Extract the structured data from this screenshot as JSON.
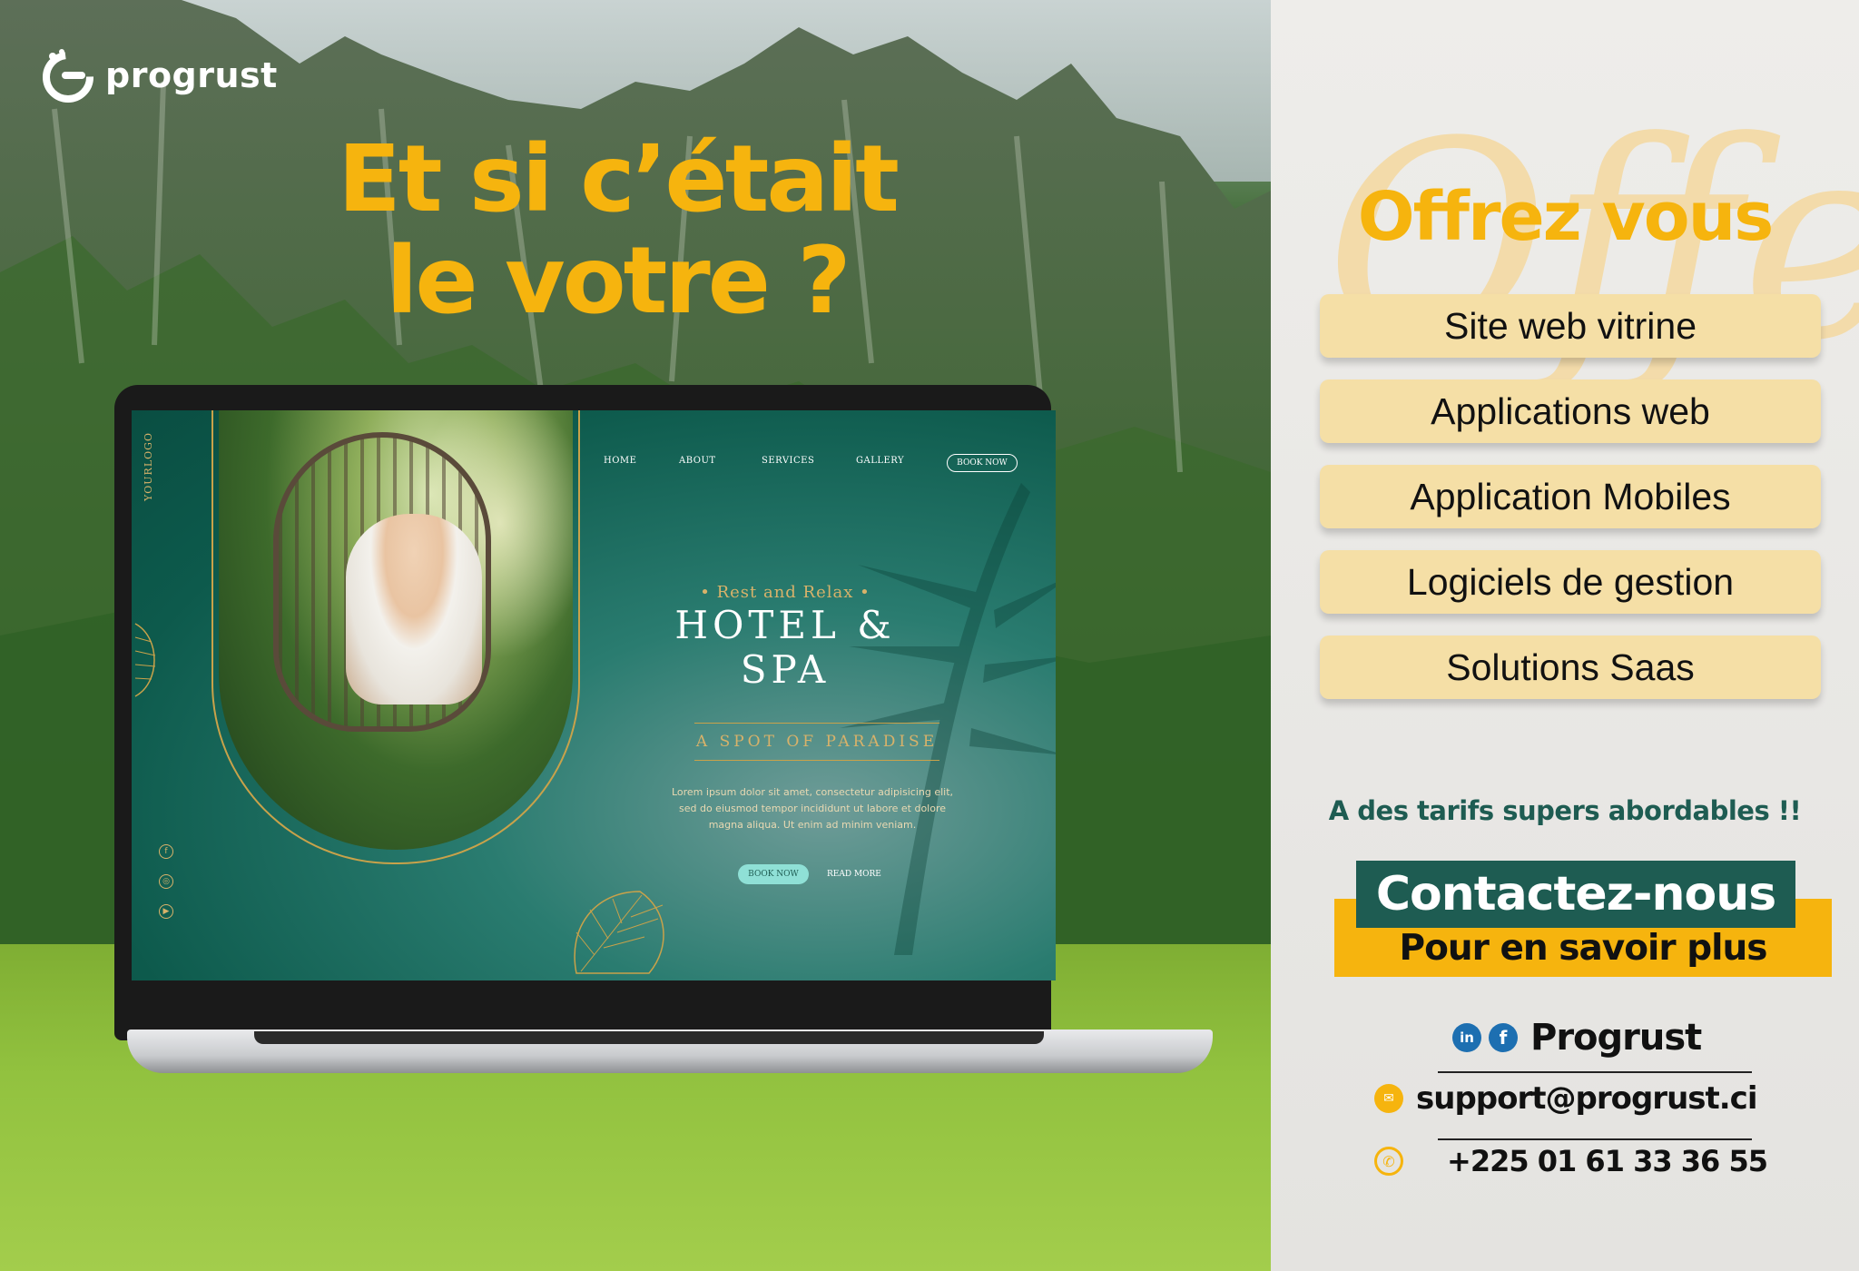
{
  "brand": {
    "name": "progrust",
    "color_yellow": "#f6b40e",
    "color_green": "#1e5c52"
  },
  "headline": {
    "line1": "Et si c’était",
    "line2": "le votre ?"
  },
  "mockup": {
    "logo_vertical": "YOURLOGO",
    "nav": [
      "HOME",
      "ABOUT",
      "SERVICES",
      "GALLERY"
    ],
    "nav_cta": "BOOK NOW",
    "kicker": "• Rest and Relax •",
    "title": "HOTEL & SPA",
    "tagline": "A SPOT OF PARADISE",
    "body": "Lorem ipsum dolor sit amet, consectetur adipisicing elit, sed do eiusmod tempor incididunt ut labore et dolore magna aliqua. Ut enim ad minim veniam.",
    "primary_button": "BOOK NOW",
    "secondary_link": "READ MORE",
    "social_icons": [
      "facebook-icon",
      "instagram-icon",
      "youtube-icon"
    ]
  },
  "offer": {
    "script_word": "Offer",
    "heading": "Offrez vous",
    "items": [
      "Site web vitrine",
      "Applications web",
      "Application Mobiles",
      "Logiciels de gestion",
      "Solutions Saas"
    ]
  },
  "pricing_note": "A des tarifs supers abordables !!",
  "contact": {
    "title": "Contactez-nous",
    "subtitle": "Pour en savoir plus",
    "social_name": "Progrust",
    "email": "support@progrust.ci",
    "phone": "+225 01 61 33 36 55"
  }
}
